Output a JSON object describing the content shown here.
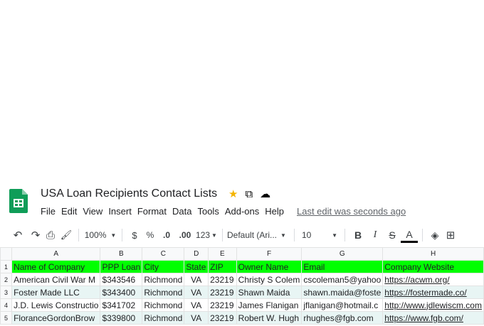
{
  "doc": {
    "title": "USA Loan Recipients Contact Lists",
    "last_edit": "Last edit was seconds ago"
  },
  "icons": {
    "star": "★",
    "move": "⧉",
    "cloud": "☁"
  },
  "menu": [
    "File",
    "Edit",
    "View",
    "Insert",
    "Format",
    "Data",
    "Tools",
    "Add-ons",
    "Help"
  ],
  "toolbar": {
    "undo": "↶",
    "redo": "↷",
    "print": "⎙",
    "paint_format": "🖌",
    "zoom": "100%",
    "currency": "$",
    "percent": "%",
    "decrease_decimal": ".0",
    "increase_decimal": ".00",
    "number_format": "123",
    "font": "Default (Ari...",
    "font_size": "10",
    "bold": "B",
    "italic": "I",
    "strikethrough": "S",
    "text_color": "A",
    "fill_color": "◈",
    "borders": "⊞"
  },
  "columns": [
    "A",
    "B",
    "C",
    "D",
    "E",
    "F",
    "G",
    "H"
  ],
  "rows": [
    {
      "num": "1",
      "cells": [
        "Name of Company",
        "PPP Loan",
        "City",
        "State",
        "ZIP",
        "Owner Name",
        "Email",
        "Company Website"
      ]
    },
    {
      "num": "2",
      "cells": [
        "American Civil War M",
        "$343546",
        "Richmond",
        "VA",
        "23219",
        "Christy S Colem",
        "cscoleman5@yahoo",
        "https://acwm.org/"
      ]
    },
    {
      "num": "3",
      "cells": [
        "Foster Made LLC",
        "$343400",
        "Richmond",
        "VA",
        "23219",
        "Shawn Maida",
        "shawn.maida@foste",
        "https://fostermade.co/"
      ]
    },
    {
      "num": "4",
      "cells": [
        "J.D. Lewis Constructio",
        "$341702",
        "Richmond",
        "VA",
        "23219",
        "James Flanigan",
        "jflanigan@hotmail.c",
        "http://www.jdlewiscm.com"
      ]
    },
    {
      "num": "5",
      "cells": [
        "FloranceGordonBrow",
        "$339800",
        "Richmond",
        "VA",
        "23219",
        "Robert W. Hugh",
        "rhughes@fgb.com",
        "https://www.fgb.com/"
      ]
    }
  ],
  "colors": {
    "header_fill": "#00ff00",
    "alt_row_fill": "#e8f5f4",
    "link": "#1155cc",
    "sheets_green": "#0f9d58"
  }
}
